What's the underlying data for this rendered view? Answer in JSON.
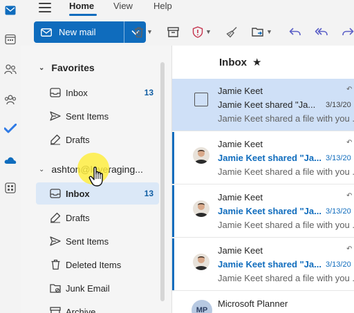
{
  "menu": {
    "home": "Home",
    "view": "View",
    "help": "Help"
  },
  "toolbar": {
    "new_mail": "New mail"
  },
  "folders": {
    "favorites_header": "Favorites",
    "favorites": [
      {
        "label": "Inbox",
        "count": "13"
      },
      {
        "label": "Sent Items"
      },
      {
        "label": "Drafts"
      }
    ],
    "account_header": "ashton@leveraging...",
    "account_items": [
      {
        "label": "Inbox",
        "count": "13"
      },
      {
        "label": "Drafts"
      },
      {
        "label": "Sent Items"
      },
      {
        "label": "Deleted Items"
      },
      {
        "label": "Junk Email"
      },
      {
        "label": "Archive"
      }
    ]
  },
  "list": {
    "title": "Inbox",
    "messages": [
      {
        "sender": "Jamie Keet",
        "subject": "Jamie Keet shared \"Ja...",
        "date": "3/13/20",
        "preview": "Jamie Keet shared a file with you ..."
      },
      {
        "sender": "Jamie Keet",
        "subject": "Jamie Keet shared \"Ja...",
        "date": "3/13/20",
        "preview": "Jamie Keet shared a file with you ..."
      },
      {
        "sender": "Jamie Keet",
        "subject": "Jamie Keet shared \"Ja...",
        "date": "3/13/20",
        "preview": "Jamie Keet shared a file with you ..."
      },
      {
        "sender": "Jamie Keet",
        "subject": "Jamie Keet shared \"Ja...",
        "date": "3/13/20",
        "preview": "Jamie Keet shared a file with you ..."
      },
      {
        "sender": "Microsoft Planner",
        "avatar_initials": "MP"
      }
    ]
  },
  "icons": {
    "rail": [
      "mail-icon",
      "calendar-icon",
      "people-icon",
      "groups-icon",
      "todo-icon",
      "onedrive-icon",
      "apps-icon"
    ]
  },
  "colors": {
    "accent": "#0f6cbd",
    "selected_bg": "#cfe0f7",
    "highlight": "#ffee3c"
  }
}
